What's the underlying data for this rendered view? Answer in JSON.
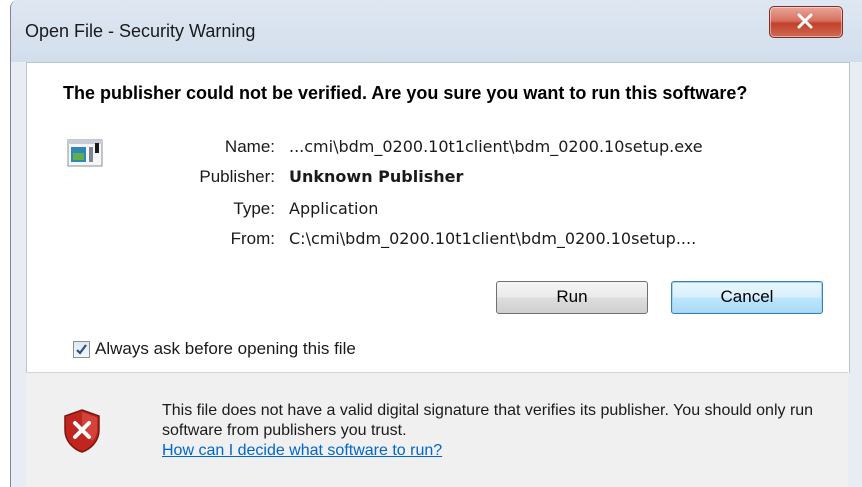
{
  "window": {
    "title": "Open File - Security Warning",
    "close_icon": "close-x-icon"
  },
  "warning": {
    "headline": "The publisher could not be verified.  Are you sure you want to run this software?"
  },
  "file_info": {
    "icon": "application-file-icon",
    "rows": [
      {
        "label": "Name:",
        "value": "...cmi\\bdm_0200.10t1client\\bdm_0200.10setup.exe"
      },
      {
        "label": "Publisher:",
        "value": "Unknown Publisher"
      },
      {
        "label": "Type:",
        "value": "Application"
      },
      {
        "label": "From:",
        "value": "C:\\cmi\\bdm_0200.10t1client\\bdm_0200.10setup...."
      }
    ]
  },
  "buttons": {
    "run": "Run",
    "cancel": "Cancel"
  },
  "checkbox": {
    "label": "Always ask before opening this file",
    "checked": true
  },
  "footer": {
    "icon": "security-shield-error-icon",
    "text": "This file does not have a valid digital signature that verifies its publisher.  You should only run software from publishers you trust.",
    "link": "How can I decide what software to run?"
  },
  "colors": {
    "link": "#0066cc",
    "shield_red": "#c0251f",
    "default_button_border": "#3c7fb1"
  }
}
